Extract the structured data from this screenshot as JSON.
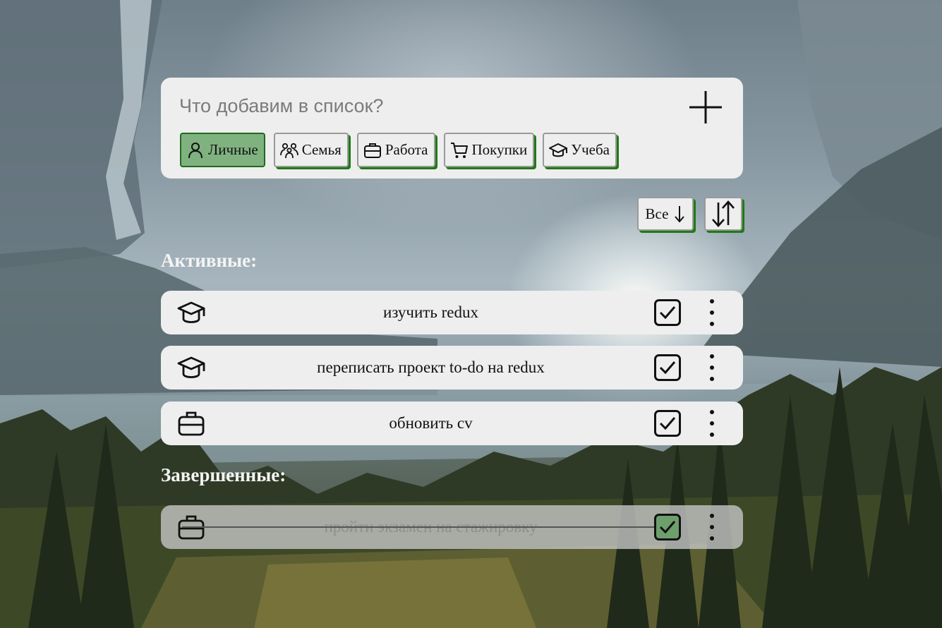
{
  "add_panel": {
    "placeholder": "Что добавим в список?",
    "add_icon": "plus-icon"
  },
  "categories": [
    {
      "label": "Личные",
      "icon": "person-icon",
      "active": true
    },
    {
      "label": "Семья",
      "icon": "family-icon",
      "active": false
    },
    {
      "label": "Работа",
      "icon": "briefcase-icon",
      "active": false
    },
    {
      "label": "Покупки",
      "icon": "cart-icon",
      "active": false
    },
    {
      "label": "Учеба",
      "icon": "graduation-cap-icon",
      "active": false
    }
  ],
  "controls": {
    "filter_label": "Все",
    "filter_icon": "arrow-down-icon",
    "sort_icon": "sort-arrows-icon"
  },
  "sections": {
    "active_title": "Активные:",
    "done_title": "Завершенные:"
  },
  "active_tasks": [
    {
      "text": "изучить redux",
      "category_icon": "graduation-cap-icon"
    },
    {
      "text": "переписать проект to-do на redux",
      "category_icon": "graduation-cap-icon"
    },
    {
      "text": "обновить cv",
      "category_icon": "briefcase-icon"
    }
  ],
  "done_tasks": [
    {
      "text": "пройти экзамен на стажировку",
      "category_icon": "briefcase-icon"
    }
  ],
  "colors": {
    "accent_green": "#1e7a14",
    "active_category_bg": "#7fb27f",
    "done_check_bg": "#6d9f6d",
    "card_bg": "#eeeeee"
  }
}
